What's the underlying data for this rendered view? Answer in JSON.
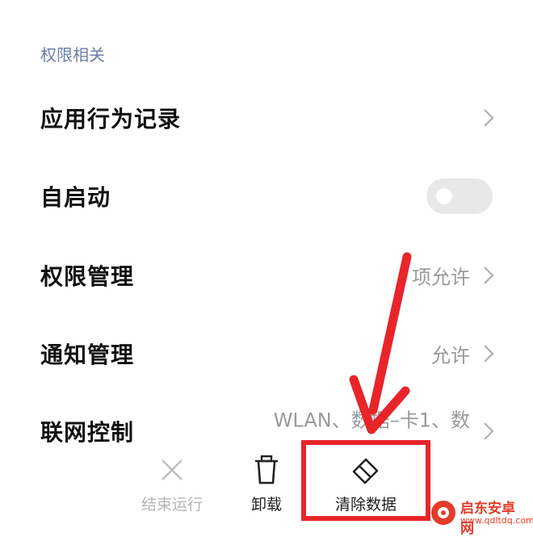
{
  "section": {
    "header": "权限相关"
  },
  "rows": [
    {
      "label": "应用行为记录",
      "value": ""
    },
    {
      "label": "自启动",
      "toggle_on": false
    },
    {
      "label": "权限管理",
      "value": "项允许"
    },
    {
      "label": "通知管理",
      "value": "允许"
    },
    {
      "label": "联网控制",
      "value": "WLAN、数据–卡1、数"
    }
  ],
  "bottom_actions": [
    {
      "label": "结束运行",
      "icon": "close-icon",
      "enabled": false
    },
    {
      "label": "卸载",
      "icon": "trash-icon",
      "enabled": true
    },
    {
      "label": "清除数据",
      "icon": "eraser-icon",
      "enabled": true
    }
  ],
  "annotation": {
    "color": "#e8252a"
  },
  "watermark": {
    "brand": "启东安卓网",
    "url": "www.qdltdq.com"
  }
}
